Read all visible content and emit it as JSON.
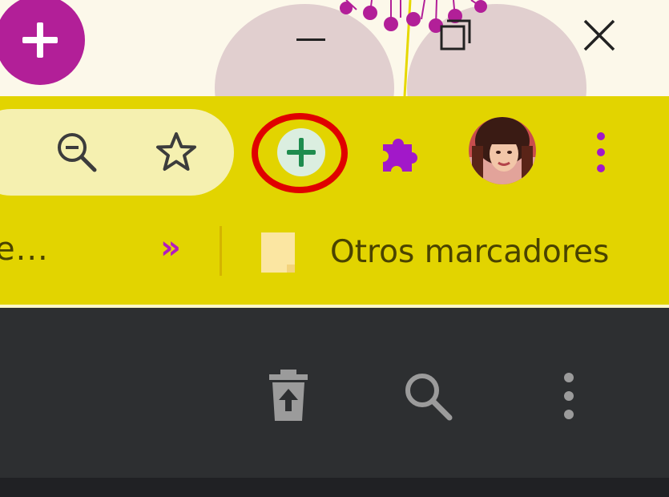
{
  "titlebar": {
    "new_tab_icon": "plus-icon",
    "minimize_icon": "minimize-icon",
    "restore_icon": "restore-icon",
    "close_icon": "close-icon"
  },
  "toolbar": {
    "zoom_icon": "zoom-out-icon",
    "bookmark_star_icon": "star-icon",
    "highlighted_extension_icon": "plus-circle-icon",
    "extensions_icon": "puzzle-icon",
    "profile_icon": "avatar",
    "menu_icon": "more-vert-icon"
  },
  "bookmarks": {
    "truncated_item": "e...",
    "overflow_label": "»",
    "other_bookmarks_label": "Otros marcadores"
  },
  "app_header": {
    "trash_icon": "restore-from-trash-icon",
    "search_icon": "search-icon",
    "menu_icon": "more-vert-icon"
  },
  "colors": {
    "toolbar_bg": "#e2d400",
    "accent_purple": "#b31ac0",
    "highlight_ring": "#e00000",
    "extension_green": "#1e8c4e",
    "dark_header": "#2d2f31"
  }
}
